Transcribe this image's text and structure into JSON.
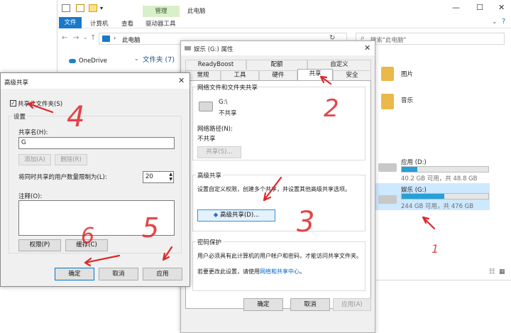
{
  "explorer": {
    "manage_tab": "管理",
    "title": "此电脑",
    "ribbon": {
      "file": "文件",
      "computer": "计算机",
      "view": "查看",
      "drive_tools": "驱动器工具"
    },
    "address": "此电脑",
    "search_placeholder": "搜索\"此电脑\"",
    "nav": {
      "onedrive": "OneDrive"
    },
    "folders_header": "文件夹 (7)",
    "folder_items": [
      "图片",
      "音乐"
    ],
    "drives": [
      {
        "name": "应用 (D:)",
        "info": "40.2 GB 可用，共 48.8 GB",
        "used_fraction": 0.18
      },
      {
        "name": "娱乐 (G:)",
        "info": "244 GB 可用，共 476 GB",
        "used_fraction": 0.49
      }
    ]
  },
  "props": {
    "title": "娱乐 (G:) 属性",
    "tabs_row1": [
      "ReadyBoost",
      "配额",
      "自定义"
    ],
    "tabs_row2": [
      "常规",
      "工具",
      "硬件",
      "共享",
      "安全"
    ],
    "network_group": "网络文件和文件夹共享",
    "drive_path": "G:\\",
    "share_status": "不共享",
    "network_path_label": "网络路径(N):",
    "network_path_value": "不共享",
    "share_button": "共享(S)...",
    "advanced_group": "高级共享",
    "advanced_desc": "设置自定义权限，创建多个共享，并设置其他高级共享选项。",
    "advanced_button": "高级共享(D)...",
    "password_group": "密码保护",
    "password_desc": "用户必须具有此计算机的用户帐户和密码，才能访问共享文件夹。",
    "password_change_prefix": "若要更改此设置，请使用",
    "password_change_link": "网络和共享中心",
    "password_change_suffix": "。",
    "ok": "确定",
    "cancel": "取消",
    "apply": "应用(A)"
  },
  "adv": {
    "title": "高级共享",
    "share_checkbox": "共享此文件夹(S)",
    "settings_label": "设置",
    "share_name_label": "共享名(H):",
    "share_name_value": "G",
    "add_button": "添加(A)",
    "remove_button": "删除(R)",
    "limit_label": "将同时共享的用户数量限制为(L):",
    "limit_value": "20",
    "comment_label": "注释(O):",
    "permissions_button": "权限(P)",
    "cache_button": "缓存(C)",
    "ok": "确定",
    "cancel": "取消",
    "apply": "应用"
  },
  "annotations": {
    "n1": "1",
    "n2": "2",
    "n3": "3",
    "n4": "4",
    "n5": "5",
    "n6": "6"
  },
  "colors": {
    "accent": "#1979ca",
    "drive_fill": "#26a0da",
    "annotation": "#e0262a",
    "selection": "#cde8ff"
  }
}
